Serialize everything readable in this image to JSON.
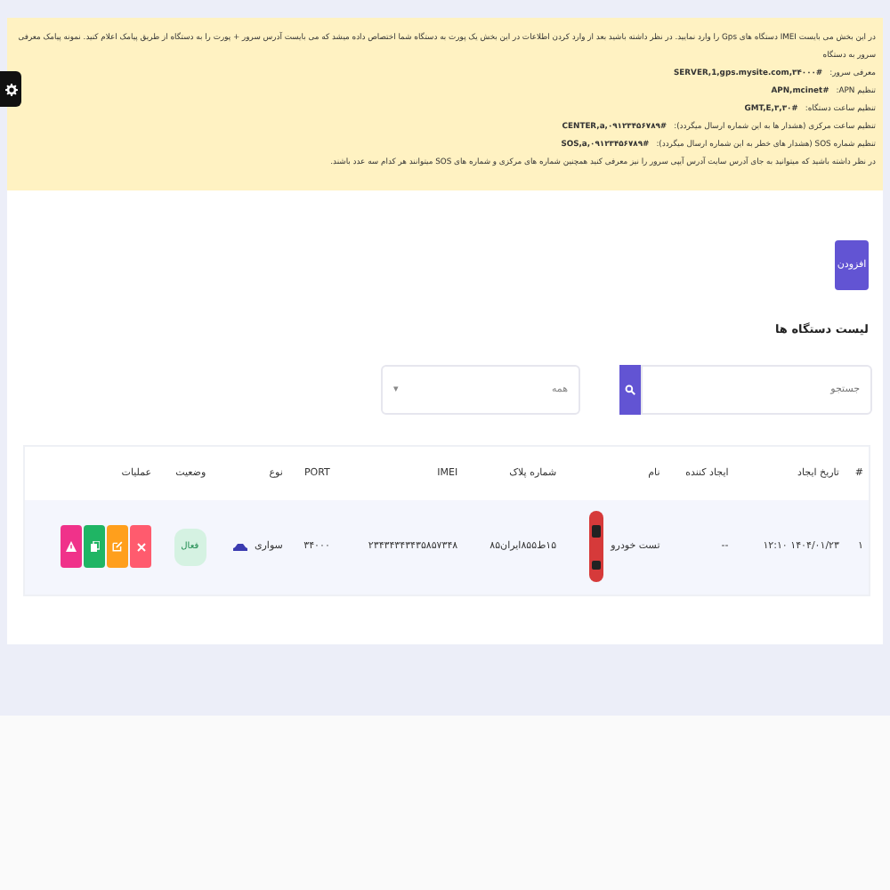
{
  "notice": {
    "lines": [
      {
        "label": "در این بخش می بایست IMEI دستگاه های Gps را وارد نمایید. در نظر داشته باشید بعد از وارد کردن اطلاعات در این بخش یک پورت به دستگاه شما اختصاص داده میشد که می بایست آدرس سرور + پورت را به دستگاه از طریق پیامک اعلام کنید. نمونه پیامک معرفی سرور به دستگاه"
      },
      {
        "label": "معرفی سرور:",
        "code": "SERVER,1,gps.mysite.com,۳۴۰۰۰#"
      },
      {
        "label": "تنظیم APN:",
        "code": "APN,mcinet#"
      },
      {
        "label": "تنظیم ساعت دستگاه:",
        "code": "GMT,E,۳,۳۰#"
      },
      {
        "label": "تنظیم ساعت مرکزی (هشدار ها به این شماره ارسال میگردد):",
        "code": "CENTER,a,۰۹۱۲۳۴۵۶۷۸۹#"
      },
      {
        "label": "تنظیم شماره SOS (هشدار های خطر به این شماره ارسال میگردد):",
        "code": "SOS,a,۰۹۱۲۳۴۵۶۷۸۹#"
      },
      {
        "label": "در نظر داشته باشید که میتوانید به جای آدرس سایت آدرس آیپی سرور را نیز معرفی کنید همچنین شماره های مرکزی و شماره های SOS میتوانند هر کدام سه عدد باشند."
      }
    ]
  },
  "add_button": "افزودن",
  "list_title": "لیست دستگاه ها",
  "search": {
    "placeholder": "جستجو"
  },
  "filter": {
    "value": "همه",
    "caret": "▾"
  },
  "table": {
    "columns": [
      "#",
      "تاریخ ایجاد",
      "ایجاد کننده",
      "نام",
      "شماره پلاک",
      "IMEI",
      "PORT",
      "نوع",
      "وضعیت",
      "عملیات"
    ],
    "rows": [
      {
        "index": "۱",
        "created": "۱۴۰۴/۰۱/۲۳ ۱۲:۱۰",
        "creator": "--",
        "name": "تست خودرو",
        "plate": "۱۵ط۸۵۵ایران۸۵",
        "imei": "۲۳۴۳۴۳۴۳۴۳۵۸۵۷۳۴۸",
        "port": "۳۴۰۰۰",
        "type": "سواری",
        "status": {
          "label": "فعال",
          "active": true
        },
        "actions": [
          {
            "kind": "delete",
            "color": "#ff5b6e"
          },
          {
            "kind": "edit",
            "color": "#ff9f1c"
          },
          {
            "kind": "copy",
            "color": "#1fb564"
          },
          {
            "kind": "alert",
            "color": "#f0328a"
          }
        ]
      }
    ]
  }
}
